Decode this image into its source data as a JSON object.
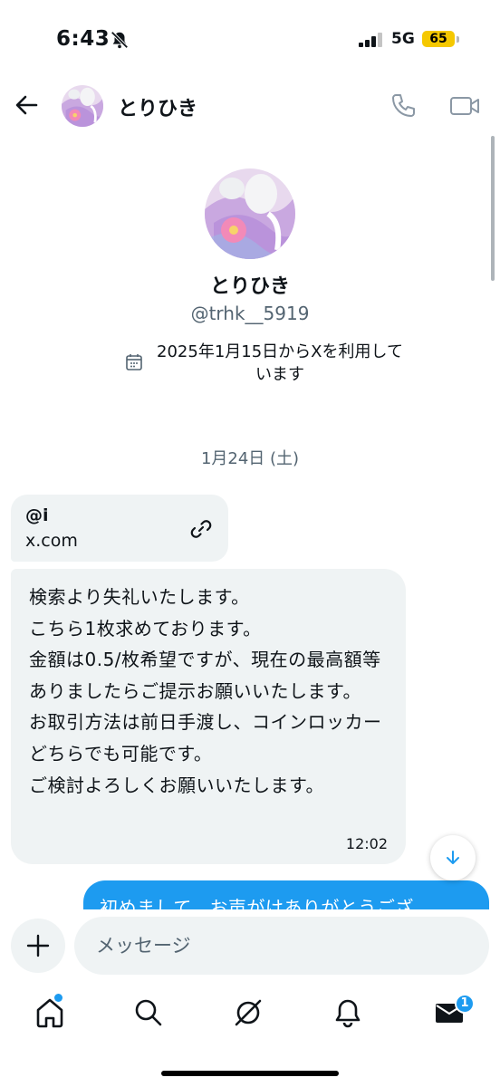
{
  "status_bar": {
    "time": "6:43",
    "network": "5G",
    "battery": "65",
    "battery_color": "#f5c800"
  },
  "header": {
    "name": "とりひき",
    "icons": [
      "back-arrow-icon",
      "phone-icon",
      "video-camera-icon"
    ]
  },
  "profile": {
    "name": "とりひき",
    "handle": "@trhk__5919",
    "joined": "2025年1月15日からXを利用しています"
  },
  "conversation": {
    "date_separator": "1月24日 (土)",
    "link_card": {
      "title": "@i",
      "domain": "x.com"
    },
    "received_message": {
      "text": "検索より失礼いたします。\nこちら1枚求めております。\n金額は0.5/枚希望ですが、現在の最高額等ありましたらご提示お願いいたします。\nお取引方法は前日手渡し、コインロッカーどちらでも可能です。\nご検討よろしくお願いいたします。",
      "time": "12:02"
    },
    "sent_message_partial": "初めまして、お声がけありがとうござ"
  },
  "composer": {
    "placeholder": "メッセージ"
  },
  "bottom_nav": {
    "items": [
      "home-icon",
      "search-icon",
      "grok-icon",
      "notifications-icon",
      "messages-icon"
    ],
    "messages_badge": "1"
  },
  "colors": {
    "accent": "#1d9bf0",
    "bubble_received": "#eff3f4",
    "secondary_text": "#536471"
  }
}
